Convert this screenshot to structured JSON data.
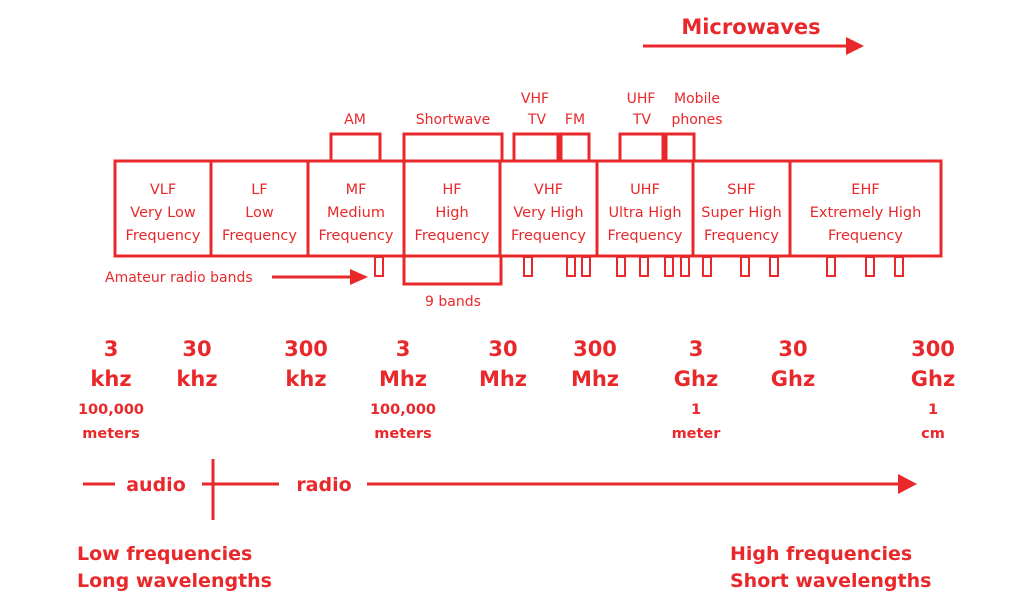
{
  "microwaves": {
    "label": "Microwaves"
  },
  "top_labels": {
    "am": [
      "AM"
    ],
    "shortwave": [
      "Shortwave"
    ],
    "vhf_tv": [
      "VHF",
      "TV"
    ],
    "fm": [
      "FM"
    ],
    "uhf_tv": [
      "UHF",
      "TV"
    ],
    "mobile": [
      "Mobile",
      "phones"
    ]
  },
  "bands": [
    {
      "abbr": "VLF",
      "lines": [
        "Very Low",
        "Frequency"
      ]
    },
    {
      "abbr": "LF",
      "lines": [
        "Low",
        "Frequency"
      ]
    },
    {
      "abbr": "MF",
      "lines": [
        "Medium",
        "Frequency"
      ]
    },
    {
      "abbr": "HF",
      "lines": [
        "High",
        "Frequency"
      ]
    },
    {
      "abbr": "VHF",
      "lines": [
        "Very High",
        "Frequency"
      ]
    },
    {
      "abbr": "UHF",
      "lines": [
        "Ultra High",
        "Frequency"
      ]
    },
    {
      "abbr": "SHF",
      "lines": [
        "Super High",
        "Frequency"
      ]
    },
    {
      "abbr": "EHF",
      "lines": [
        "Extremely High",
        "Frequency"
      ]
    }
  ],
  "amateur": {
    "label": "Amateur radio bands",
    "count": 14
  },
  "hf_bands_label": "9 bands",
  "frequencies": [
    {
      "value": "3",
      "unit": "khz",
      "wavelength": [
        "100,000",
        "meters"
      ]
    },
    {
      "value": "30",
      "unit": "khz",
      "wavelength": []
    },
    {
      "value": "300",
      "unit": "khz",
      "wavelength": []
    },
    {
      "value": "3",
      "unit": "Mhz",
      "wavelength": [
        "100,000",
        "meters"
      ]
    },
    {
      "value": "30",
      "unit": "Mhz",
      "wavelength": []
    },
    {
      "value": "300",
      "unit": "Mhz",
      "wavelength": []
    },
    {
      "value": "3",
      "unit": "Ghz",
      "wavelength": [
        "1",
        "meter"
      ]
    },
    {
      "value": "30",
      "unit": "Ghz",
      "wavelength": []
    },
    {
      "value": "300",
      "unit": "Ghz",
      "wavelength": [
        "1",
        "cm"
      ]
    }
  ],
  "axis": {
    "audio": "audio",
    "radio": "radio"
  },
  "footer": {
    "left": [
      "Low frequencies",
      "Long wavelengths"
    ],
    "right": [
      "High frequencies",
      "Short wavelengths"
    ]
  },
  "colors": {
    "accent": "#e8282b",
    "background": "#ffffff"
  }
}
